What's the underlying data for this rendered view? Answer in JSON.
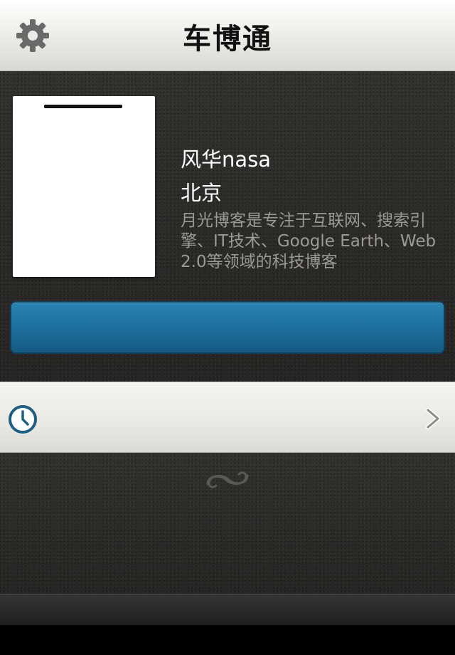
{
  "navbar": {
    "title": "车博通",
    "settings_icon": "gear-icon"
  },
  "profile": {
    "name": "风华nasa",
    "city": "北京",
    "description": "月光博客是专注于互联网、搜索引擎、IT技术、Google Earth、Web 2.0等领域的科技博客"
  },
  "action_button": {
    "label": "",
    "color": "#1d6f9e"
  },
  "history_row": {
    "icon": "clock-icon",
    "label": "",
    "chevron": "chevron-right-icon"
  },
  "decoration": {
    "icon": "flourish-icon"
  },
  "colors": {
    "navbar_bg": "#f1f0ec",
    "leather_bg": "#2e2c2a",
    "accent_blue": "#1d6f9e",
    "description_text": "#9c9a97"
  }
}
